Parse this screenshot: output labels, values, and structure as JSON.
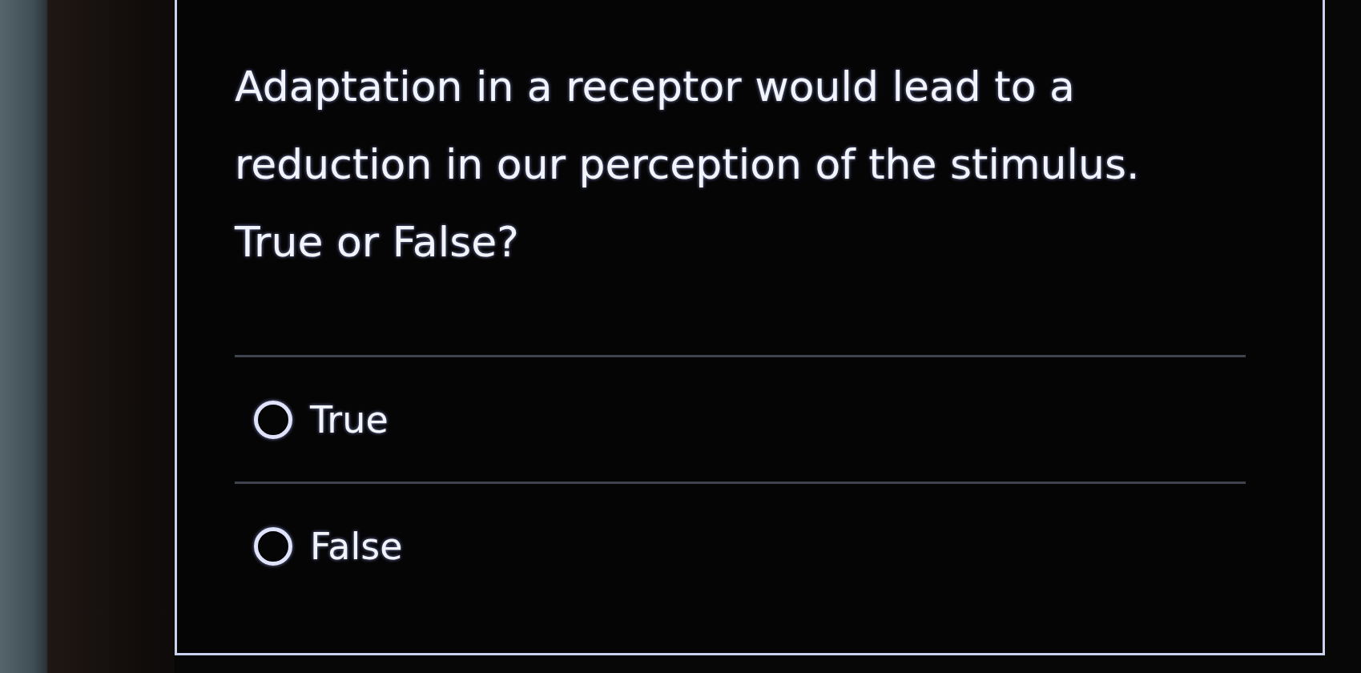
{
  "question": {
    "text": "Adaptation in a receptor would lead to a reduction in our perception of the stimulus.",
    "prompt": "True or False?"
  },
  "options": [
    {
      "label": "True",
      "selected": false
    },
    {
      "label": "False",
      "selected": false
    }
  ]
}
